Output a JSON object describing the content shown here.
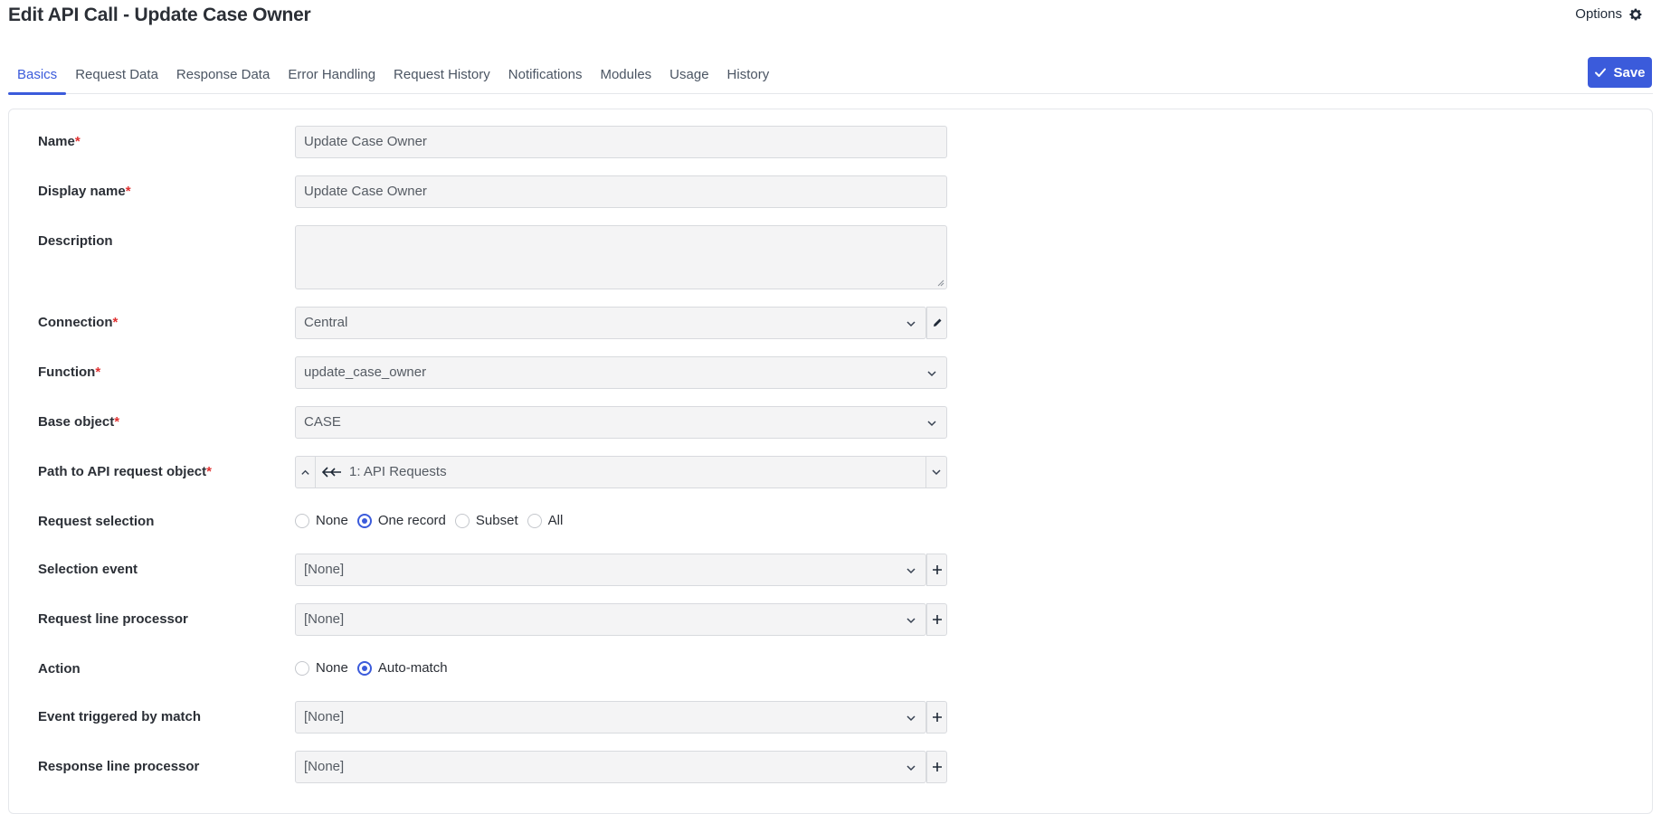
{
  "header": {
    "title": "Edit API Call - Update Case Owner",
    "options_label": "Options",
    "options_icon": "gear-icon"
  },
  "tabs": [
    {
      "label": "Basics",
      "active": true
    },
    {
      "label": "Request Data"
    },
    {
      "label": "Response Data"
    },
    {
      "label": "Error Handling"
    },
    {
      "label": "Request History"
    },
    {
      "label": "Notifications"
    },
    {
      "label": "Modules"
    },
    {
      "label": "Usage"
    },
    {
      "label": "History"
    }
  ],
  "toolbar": {
    "save_label": "Save",
    "accent_color": "#3b5bdb"
  },
  "form": {
    "name": {
      "label": "Name",
      "value": "Update Case Owner"
    },
    "display_name": {
      "label": "Display name",
      "value": "Update Case Owner"
    },
    "description": {
      "label": "Description",
      "value": ""
    },
    "connection": {
      "label": "Connection",
      "value": "Central"
    },
    "function": {
      "label": "Function",
      "value": "update_case_owner"
    },
    "base_object": {
      "label": "Base object",
      "value": "CASE"
    },
    "path": {
      "label": "Path to API request object",
      "value": "1: API Requests"
    },
    "request_selection": {
      "label": "Request selection",
      "options": [
        "None",
        "One record",
        "Subset",
        "All"
      ],
      "selected": "One record"
    },
    "selection_event": {
      "label": "Selection event",
      "value": "[None]"
    },
    "request_line_processor": {
      "label": "Request line processor",
      "value": "[None]"
    },
    "action": {
      "label": "Action",
      "options": [
        "None",
        "Auto-match"
      ],
      "selected": "Auto-match"
    },
    "event_triggered": {
      "label": "Event triggered by match",
      "value": "[None]"
    },
    "response_line_processor": {
      "label": "Response line processor",
      "value": "[None]"
    }
  },
  "required_marker": "*"
}
